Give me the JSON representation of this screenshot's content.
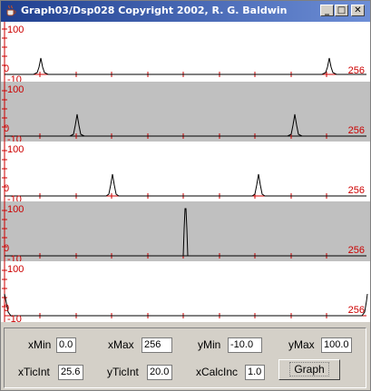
{
  "window": {
    "title": "Graph03/Dsp028 Copyright 2002, R. G. Baldwin",
    "minimize_glyph": "_",
    "maximize_glyph": "□",
    "close_glyph": "✕"
  },
  "plots": [
    {
      "background": "white",
      "y_top_label": "100",
      "y_zero_label": "0",
      "y_bottom_label": "-10",
      "x_max_label": "256"
    },
    {
      "background": "gray",
      "y_top_label": "100",
      "y_zero_label": "0",
      "y_bottom_label": "-10",
      "x_max_label": "256"
    },
    {
      "background": "white",
      "y_top_label": "100",
      "y_zero_label": "0",
      "y_bottom_label": "-10",
      "x_max_label": "256"
    },
    {
      "background": "gray",
      "y_top_label": "100",
      "y_zero_label": "0",
      "y_bottom_label": "-10",
      "x_max_label": "256"
    },
    {
      "background": "white",
      "y_top_label": "100",
      "y_zero_label": "0",
      "y_bottom_label": "-10",
      "x_max_label": "256"
    }
  ],
  "controls": {
    "xMin_label": "xMin",
    "xMin_value": "0.0",
    "xMax_label": "xMax",
    "xMax_value": "256",
    "yMin_label": "yMin",
    "yMin_value": "-10.0",
    "yMax_label": "yMax",
    "yMax_value": "100.0",
    "xTicInt_label": "xTicInt",
    "xTicInt_value": "25.6",
    "yTicInt_label": "yTicInt",
    "yTicInt_value": "20.0",
    "xCalcInc_label": "xCalcInc",
    "xCalcInc_value": "1.0",
    "graph_button": "Graph"
  },
  "colors": {
    "axis": "#cc0000",
    "trace": "#000000",
    "titlebar_start": "#1f3f8f",
    "titlebar_end": "#6d8ed6"
  }
}
